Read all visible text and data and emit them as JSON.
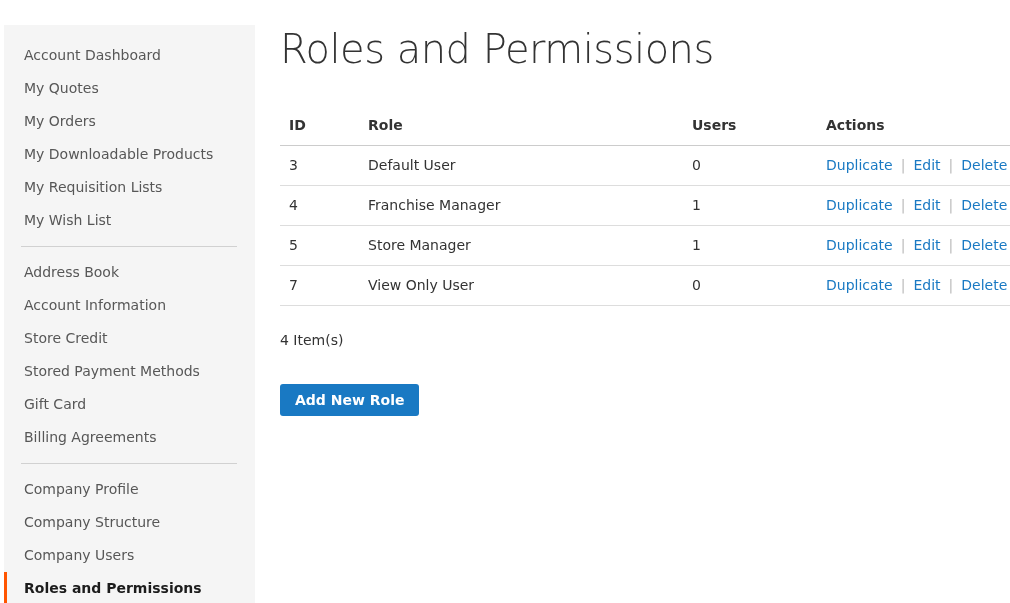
{
  "sidebar": {
    "groups": [
      {
        "items": [
          {
            "label": "Account Dashboard",
            "selected": false
          },
          {
            "label": "My Quotes",
            "selected": false
          },
          {
            "label": "My Orders",
            "selected": false
          },
          {
            "label": "My Downloadable Products",
            "selected": false
          },
          {
            "label": "My Requisition Lists",
            "selected": false
          },
          {
            "label": "My Wish List",
            "selected": false
          }
        ]
      },
      {
        "items": [
          {
            "label": "Address Book",
            "selected": false
          },
          {
            "label": "Account Information",
            "selected": false
          },
          {
            "label": "Store Credit",
            "selected": false
          },
          {
            "label": "Stored Payment Methods",
            "selected": false
          },
          {
            "label": "Gift Card",
            "selected": false
          },
          {
            "label": "Billing Agreements",
            "selected": false
          }
        ]
      },
      {
        "items": [
          {
            "label": "Company Profile",
            "selected": false
          },
          {
            "label": "Company Structure",
            "selected": false
          },
          {
            "label": "Company Users",
            "selected": false
          },
          {
            "label": "Roles and Permissions",
            "selected": true
          }
        ]
      }
    ]
  },
  "page_title": "Roles and Permissions",
  "table": {
    "columns": [
      "ID",
      "Role",
      "Users",
      "Actions"
    ],
    "rows": [
      {
        "id": "3",
        "role": "Default User",
        "users": "0",
        "actions": [
          {
            "kind": "link",
            "text": "Duplicate"
          },
          {
            "kind": "separator",
            "text": "|"
          },
          {
            "kind": "link",
            "text": "Edit"
          },
          {
            "kind": "separator",
            "text": "|"
          },
          {
            "kind": "link",
            "text": "Delete"
          }
        ]
      },
      {
        "id": "4",
        "role": "Franchise Manager",
        "users": "1",
        "actions": [
          {
            "kind": "link",
            "text": "Duplicate"
          },
          {
            "kind": "separator",
            "text": "|"
          },
          {
            "kind": "link",
            "text": "Edit"
          },
          {
            "kind": "separator",
            "text": "|"
          },
          {
            "kind": "link",
            "text": "Delete"
          }
        ]
      },
      {
        "id": "5",
        "role": "Store Manager",
        "users": "1",
        "actions": [
          {
            "kind": "link",
            "text": "Duplicate"
          },
          {
            "kind": "separator",
            "text": "|"
          },
          {
            "kind": "link",
            "text": "Edit"
          },
          {
            "kind": "separator",
            "text": "|"
          },
          {
            "kind": "link",
            "text": "Delete"
          }
        ]
      },
      {
        "id": "7",
        "role": "View Only User",
        "users": "0",
        "actions": [
          {
            "kind": "link",
            "text": "Duplicate"
          },
          {
            "kind": "separator",
            "text": "|"
          },
          {
            "kind": "link",
            "text": "Edit"
          },
          {
            "kind": "separator",
            "text": "|"
          },
          {
            "kind": "link",
            "text": "Delete"
          }
        ]
      }
    ]
  },
  "item_count": "4 Item(s)",
  "add_button": "Add New Role"
}
